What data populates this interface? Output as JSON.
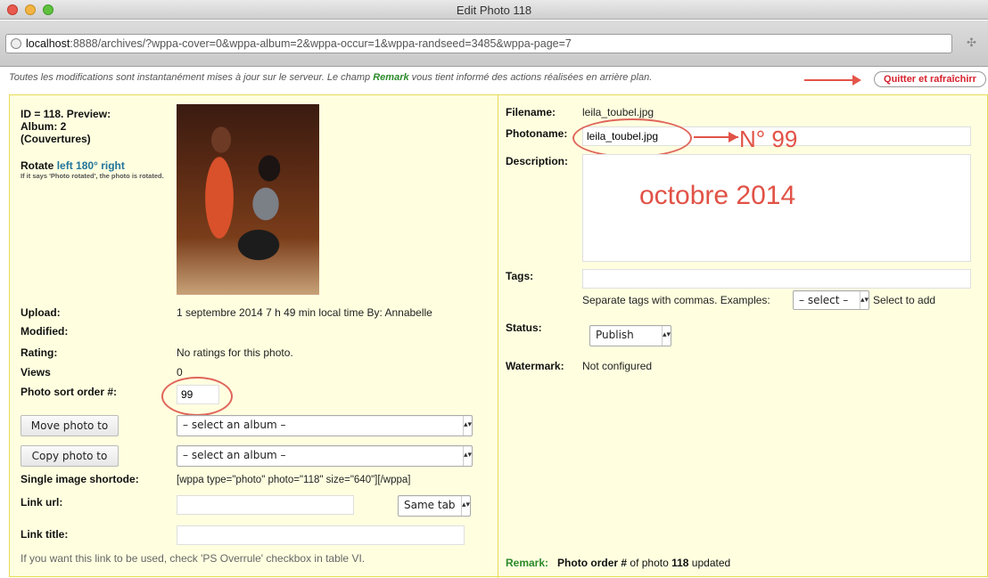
{
  "window": {
    "title": "Edit Photo 118"
  },
  "browser": {
    "url_host": "localhost",
    "url_rest": ":8888/archives/?wppa-cover=0&wppa-album=2&wppa-occur=1&wppa-randseed=3485&wppa-page=7"
  },
  "notice": {
    "before": "Toutes les modifications sont instantanément mises à jour sur le serveur. Le champ ",
    "highlight": "Remark",
    "after": " vous tient informé des actions réalisées en arrière plan."
  },
  "quit_button": "Quitter et rafraîchirr",
  "left": {
    "id_line": "ID = 118. Preview:",
    "album_line": "Album: 2",
    "album_name": "(Couvertures)",
    "rotate_label": "Rotate",
    "rotate_left": "left",
    "rotate_180": "180°",
    "rotate_right": "right",
    "rotate_note": "If it says 'Photo rotated', the photo is rotated.",
    "upload_label": "Upload:",
    "upload_value": "1 septembre 2014 7 h 49 min local time By: Annabelle",
    "modified_label": "Modified:",
    "rating_label": "Rating:",
    "rating_value": "No ratings for this photo.",
    "views_label": "Views",
    "views_value": "0",
    "sort_label": "Photo sort order #:",
    "sort_value": "99",
    "move_button": "Move photo to",
    "move_select": "– select an album –",
    "copy_button": "Copy photo to",
    "copy_select": "– select an album –",
    "shortcode_label": "Single image shortode:",
    "shortcode_value": "[wppa type=\"photo\" photo=\"118\" size=\"640\"][/wppa]",
    "link_url_label": "Link url:",
    "link_url_value": "",
    "link_target": "Same tab",
    "link_title_label": "Link title:",
    "link_title_value": "",
    "footer_note": "If you want this link to be used, check 'PS Overrule' checkbox in table VI."
  },
  "right": {
    "filename_label": "Filename:",
    "filename_value": "leila_toubel.jpg",
    "photoname_label": "Photoname:",
    "photoname_value": "leila_toubel.jpg",
    "description_label": "Description:",
    "description_value": "",
    "tags_label": "Tags:",
    "tags_value": "",
    "tags_hint": "Separate tags with commas.  Examples:",
    "tags_select": "– select –",
    "tags_select_hint": "Select to add",
    "status_label": "Status:",
    "status_value": "Publish",
    "watermark_label": "Watermark:",
    "watermark_value": "Not configured",
    "remark_label": "Remark:",
    "remark_bold": "Photo order #",
    "remark_mid": " of photo ",
    "remark_num": "118",
    "remark_end": " updated"
  },
  "annotations": {
    "number": "N° 99",
    "date": "octobre 2014"
  },
  "icons": {
    "site": "globe-icon",
    "extension": "puzzle-icon",
    "dropdown": "chevron-down-icon"
  },
  "colors": {
    "panel_bg": "#ffffe0",
    "panel_border": "#e6db55",
    "annotation": "#e15246",
    "link": "#21759b",
    "remark": "#2a8a2a",
    "quit_text": "#d6212d"
  }
}
